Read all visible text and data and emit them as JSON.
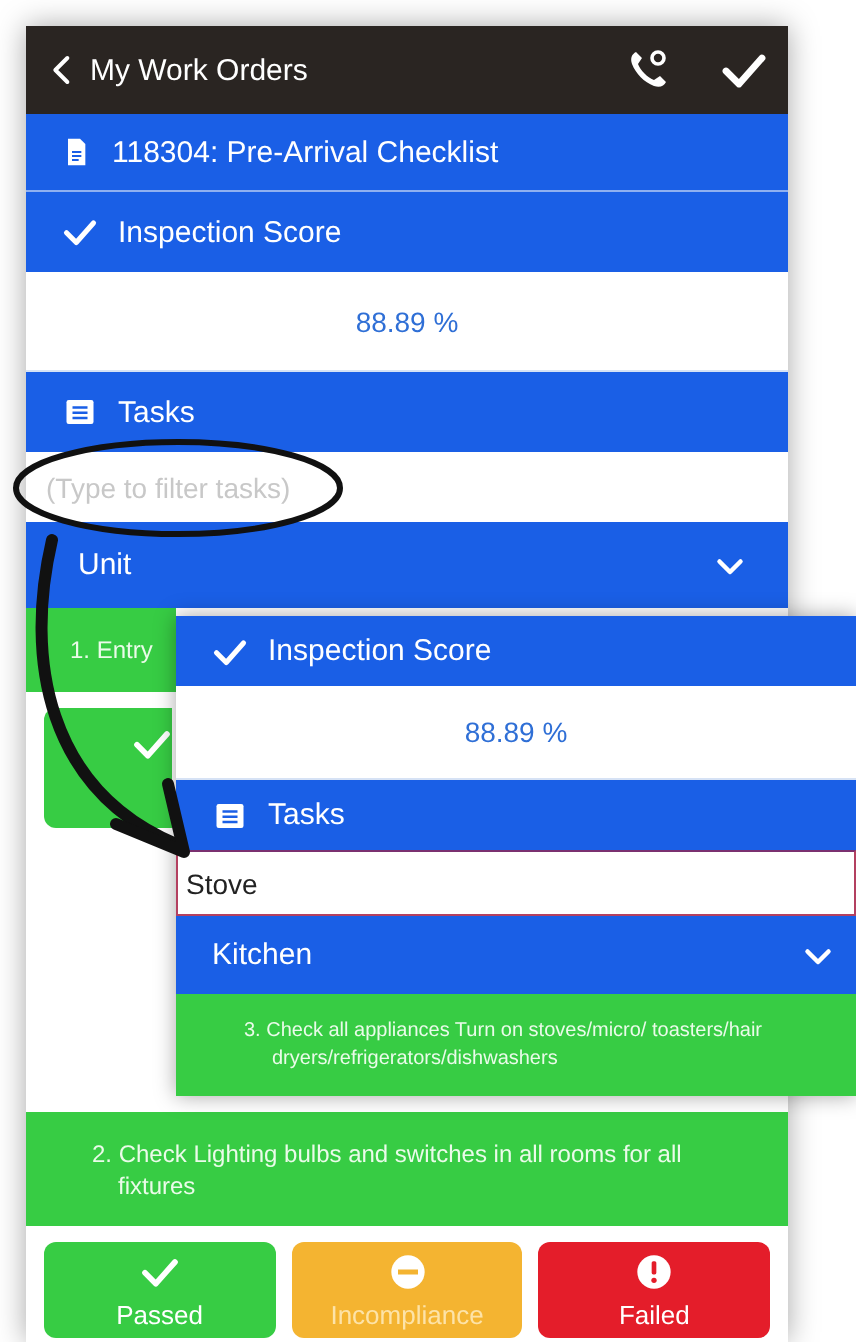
{
  "header": {
    "back_label": "My Work Orders"
  },
  "work_order": {
    "title": "118304: Pre-Arrival Checklist"
  },
  "score_section": {
    "title": "Inspection Score",
    "value": "88.89 %"
  },
  "tasks_section": {
    "title": "Tasks",
    "filter": {
      "placeholder": "(Type to filter tasks)"
    }
  },
  "group": {
    "title": "Unit"
  },
  "tasks": [
    {
      "text": "1. Entry",
      "buttons": [
        {
          "kind": "passed"
        }
      ]
    },
    {
      "text": "2. Check Lighting  bulbs and switches in all rooms for all fixtures",
      "buttons": [
        {
          "kind": "passed",
          "label": "Passed"
        },
        {
          "kind": "incompliance",
          "label": "Incompliance"
        },
        {
          "kind": "failed",
          "label": "Failed"
        }
      ]
    }
  ],
  "zoom_panel": {
    "score_title": "Inspection Score",
    "score_value": "88.89 %",
    "tasks_title": "Tasks",
    "filter": {
      "value": "Stove"
    },
    "group": "Kitchen",
    "task": "3. Check all appliances Turn on stoves/micro/ toasters/hair dryers/refrigerators/dishwashers"
  }
}
